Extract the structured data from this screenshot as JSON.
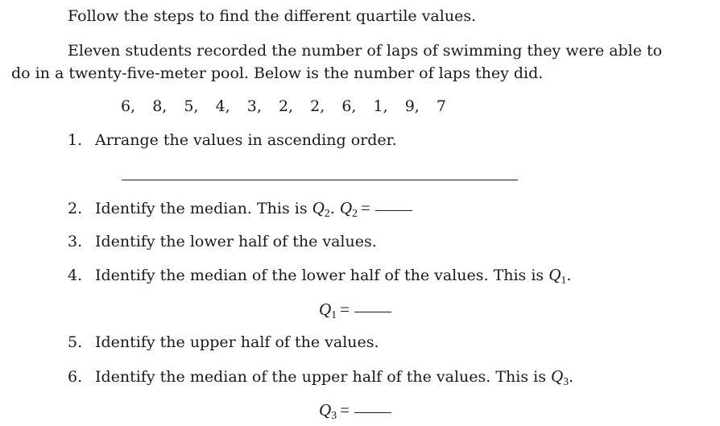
{
  "intro": "Follow the steps to find the different quartile values.",
  "problem": {
    "line1": "Eleven students recorded the number of laps of swimming they were able to",
    "line2": "do in a twenty-five-meter pool.  Below is the number of laps they did."
  },
  "values": [
    "6,",
    "8,",
    "5,",
    "4,",
    "3,",
    "2,",
    "2,",
    "6,",
    "1,",
    "9,",
    "7"
  ],
  "steps": [
    {
      "number": "1.",
      "text": "Arrange the values in ascending order."
    },
    {
      "number": "2.",
      "text": "Identify the median. This is ",
      "math_var": "Q",
      "math_sub": "2",
      "tail": ". ",
      "eq_var": "Q",
      "eq_sub": "2",
      "equals": "="
    },
    {
      "number": "3.",
      "text": "Identify the lower half of the values."
    },
    {
      "number": "4.",
      "text": "Identify the median of the lower half of the values. This is ",
      "math_var": "Q",
      "math_sub": "1",
      "tail": "."
    },
    {
      "number": "5.",
      "text": "Identify the upper half of the values."
    },
    {
      "number": "6.",
      "text": "Identify the median of the upper half of the values. This is ",
      "math_var": "Q",
      "math_sub": "3",
      "tail": "."
    }
  ],
  "q1_equation": {
    "var": "Q",
    "sub": "1",
    "equals": "="
  },
  "q3_equation": {
    "var": "Q",
    "sub": "3",
    "equals": "="
  }
}
